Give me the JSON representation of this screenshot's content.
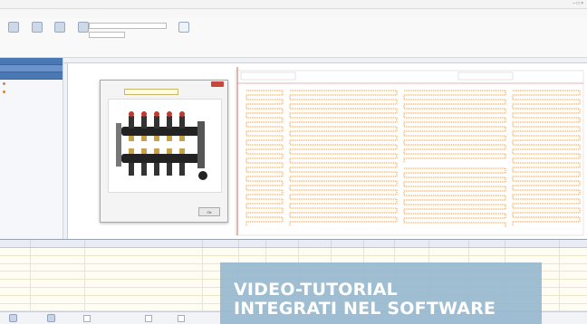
{
  "window": {
    "title": "",
    "controls": "– □ ×"
  },
  "menu": [
    "",
    "",
    "",
    "",
    ""
  ],
  "ribbon": {
    "buttons": [
      "",
      "",
      "",
      ""
    ],
    "field1_value": "",
    "field2_value": "",
    "field_label": "",
    "right_button": ""
  },
  "sidebar": {
    "headers": [
      "",
      "",
      ""
    ],
    "items": [
      "",
      ""
    ]
  },
  "dialog": {
    "title": "",
    "select_label": "",
    "select_value": "",
    "ok_label": "Ok"
  },
  "table": {
    "columns": [
      "",
      "",
      "",
      "",
      "",
      "",
      "",
      "",
      "",
      "",
      "",
      "",
      ""
    ],
    "rows": [
      [
        "",
        "",
        "",
        "",
        "",
        "",
        "",
        "",
        "",
        "",
        "",
        "",
        ""
      ],
      [
        "",
        "",
        "",
        "",
        "",
        "",
        "",
        "",
        "",
        "",
        "",
        "",
        ""
      ],
      [
        "",
        "",
        "",
        "",
        "",
        "",
        "",
        "",
        "",
        "",
        "",
        "",
        ""
      ],
      [
        "",
        "",
        "",
        "",
        "",
        "",
        "",
        "",
        "",
        "",
        "",
        "",
        ""
      ],
      [
        "",
        "",
        "",
        "",
        "",
        "",
        "",
        "",
        "",
        "",
        "",
        "",
        ""
      ],
      [
        "",
        "",
        "",
        "",
        "",
        "",
        "",
        "",
        "",
        "",
        "",
        "",
        ""
      ],
      [
        "",
        "",
        "",
        "",
        "",
        "",
        "",
        "",
        "",
        "",
        "",
        "",
        ""
      ],
      [
        "",
        "",
        "",
        "",
        "",
        "",
        "",
        "",
        "",
        "",
        "",
        "",
        ""
      ]
    ]
  },
  "statusbar": {
    "buttons": [
      "",
      "",
      ""
    ]
  },
  "banner": {
    "line1": "VIDEO-TUTORIAL",
    "line2": "INTEGRATI NEL SOFTWARE"
  },
  "colors": {
    "accent": "#4a78b5",
    "pipe": "#d9822b",
    "banner": "#97b9cf"
  }
}
